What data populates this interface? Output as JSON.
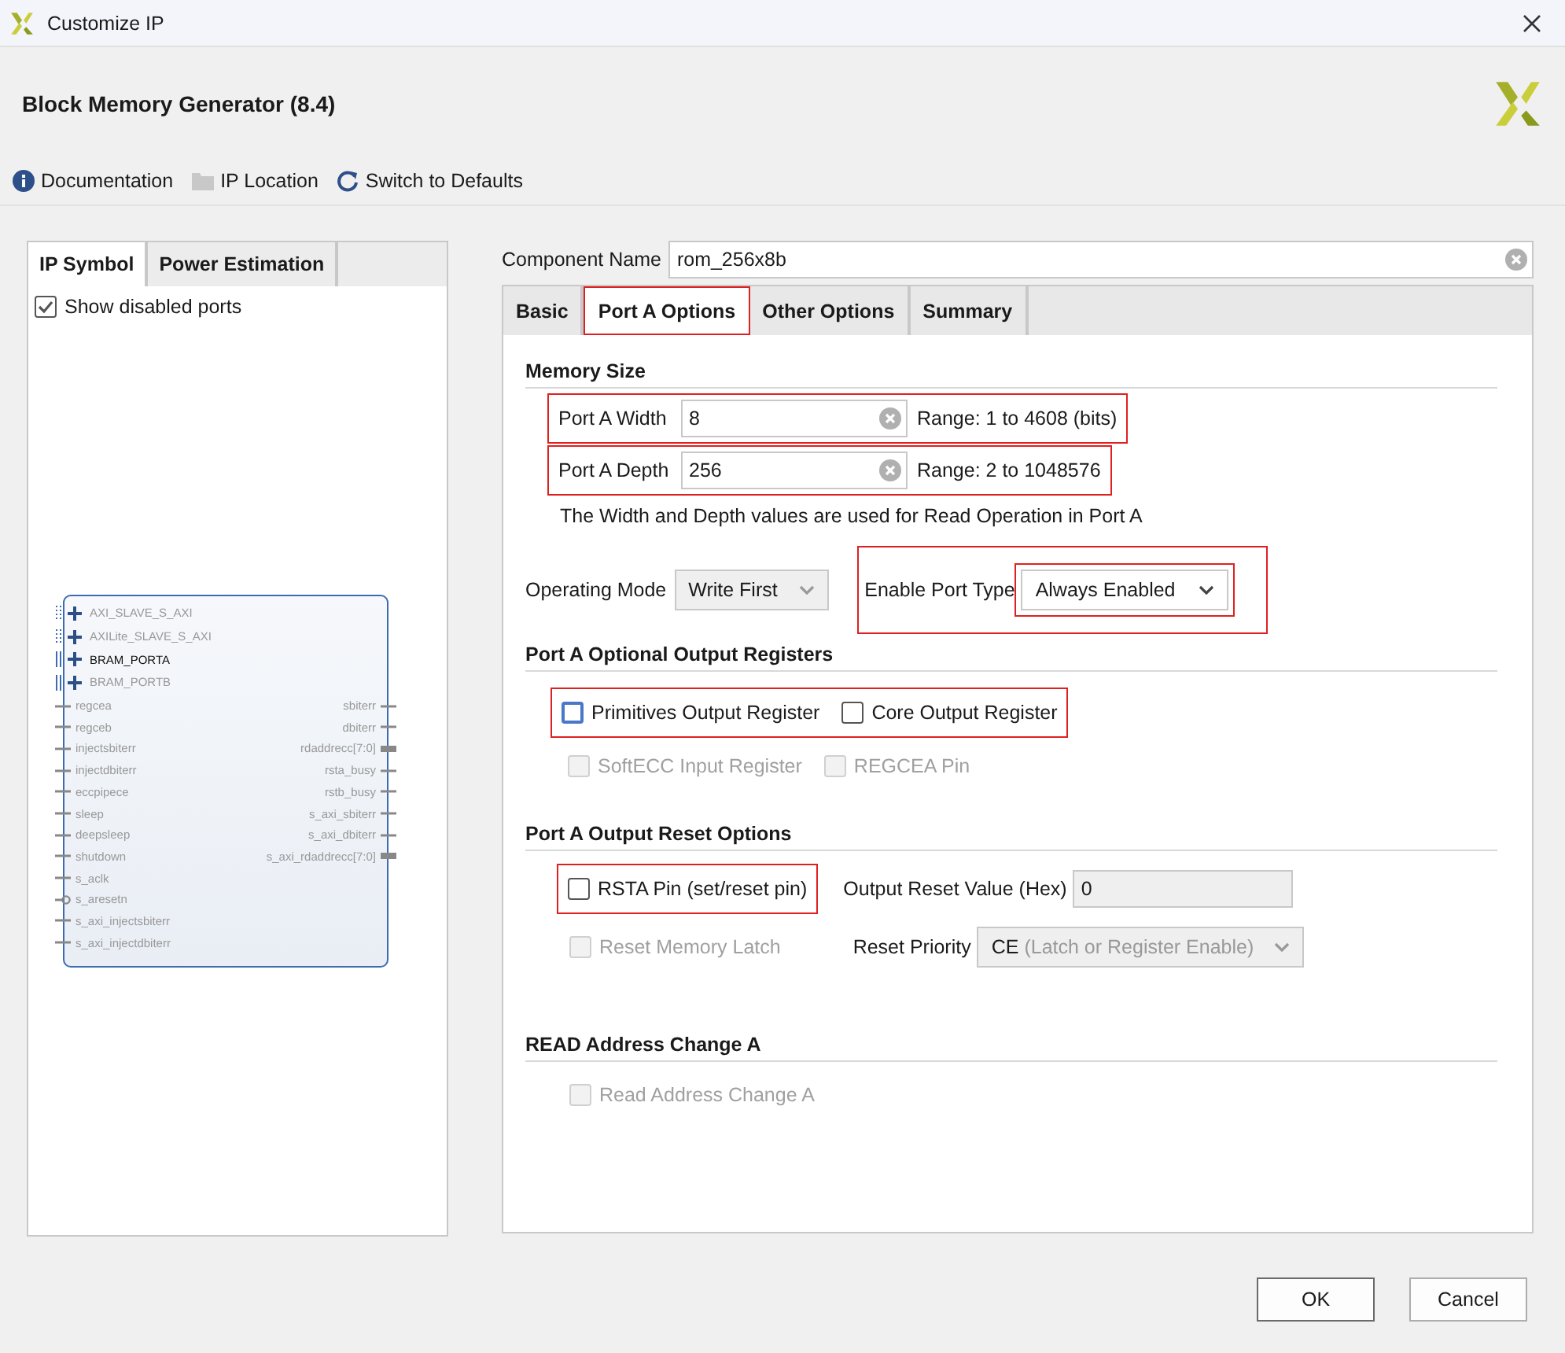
{
  "window": {
    "title": "Customize IP"
  },
  "header": {
    "title": "Block Memory Generator (8.4)"
  },
  "toolbar": [
    {
      "kind": "info",
      "label": "Documentation"
    },
    {
      "kind": "folder",
      "label": "IP Location"
    },
    {
      "kind": "refresh",
      "label": "Switch to Defaults"
    }
  ],
  "left_panel": {
    "tabs": [
      {
        "label": "IP Symbol",
        "selected": true
      },
      {
        "label": "Power Estimation",
        "selected": false
      }
    ],
    "show_disabled_ports": {
      "label": "Show disabled ports",
      "checked": true
    },
    "symbol": {
      "buses": [
        {
          "name": "AXI_SLAVE_S_AXI",
          "kind": "dotted",
          "enabled": false
        },
        {
          "name": "AXILite_SLAVE_S_AXI",
          "kind": "dotted",
          "enabled": false
        },
        {
          "name": "BRAM_PORTA",
          "kind": "solid",
          "enabled": true
        },
        {
          "name": "BRAM_PORTB",
          "kind": "solid",
          "enabled": false
        }
      ],
      "left_ports": [
        {
          "name": "regcea",
          "kind": "wire"
        },
        {
          "name": "regceb",
          "kind": "wire"
        },
        {
          "name": "injectsbiterr",
          "kind": "wire"
        },
        {
          "name": "injectdbiterr",
          "kind": "wire"
        },
        {
          "name": "eccpipece",
          "kind": "wire"
        },
        {
          "name": "sleep",
          "kind": "wire"
        },
        {
          "name": "deepsleep",
          "kind": "wire"
        },
        {
          "name": "shutdown",
          "kind": "wire"
        },
        {
          "name": "s_aclk",
          "kind": "wire"
        },
        {
          "name": "s_aresetn",
          "kind": "inverted"
        },
        {
          "name": "s_axi_injectsbiterr",
          "kind": "wire"
        },
        {
          "name": "s_axi_injectdbiterr",
          "kind": "wire"
        }
      ],
      "right_ports": [
        {
          "name": "sbiterr",
          "kind": "wire"
        },
        {
          "name": "dbiterr",
          "kind": "wire"
        },
        {
          "name": "rdaddrecc[7:0]",
          "kind": "bus"
        },
        {
          "name": "rsta_busy",
          "kind": "wire"
        },
        {
          "name": "rstb_busy",
          "kind": "wire"
        },
        {
          "name": "s_axi_sbiterr",
          "kind": "wire"
        },
        {
          "name": "s_axi_dbiterr",
          "kind": "wire"
        },
        {
          "name": "s_axi_rdaddrecc[7:0]",
          "kind": "bus"
        }
      ]
    }
  },
  "component_name": {
    "label": "Component Name",
    "value": "rom_256x8b"
  },
  "tabs": [
    {
      "label": "Basic",
      "selected": false,
      "highlighted": false
    },
    {
      "label": "Port A Options",
      "selected": true,
      "highlighted": true
    },
    {
      "label": "Other Options",
      "selected": false,
      "highlighted": false
    },
    {
      "label": "Summary",
      "selected": false,
      "highlighted": false
    }
  ],
  "memory_size": {
    "title": "Memory Size",
    "fields": [
      {
        "label": "Port A Width",
        "value": "8",
        "range": "Range: 1 to 4608 (bits)",
        "highlighted": true
      },
      {
        "label": "Port A Depth",
        "value": "256",
        "range": "Range: 2 to 1048576",
        "highlighted": true
      }
    ],
    "note": "The Width and Depth values are used for Read Operation in Port A"
  },
  "operating_mode": {
    "label": "Operating Mode",
    "value": "Write First",
    "disabled": true
  },
  "enable_port_type": {
    "label": "Enable Port Type",
    "value": "Always Enabled",
    "highlighted": true
  },
  "output_registers": {
    "title": "Port A Optional Output Registers",
    "rows": [
      {
        "highlighted": true,
        "items": [
          {
            "label": "Primitives Output Register",
            "checked": false,
            "disabled": false,
            "focused": true
          },
          {
            "label": "Core Output Register",
            "checked": false,
            "disabled": false,
            "focused": false
          }
        ]
      },
      {
        "highlighted": false,
        "items": [
          {
            "label": "SoftECC Input Register",
            "checked": false,
            "disabled": true,
            "focused": false
          },
          {
            "label": "REGCEA Pin",
            "checked": false,
            "disabled": true,
            "focused": false
          }
        ]
      }
    ]
  },
  "reset_options": {
    "title": "Port A Output Reset Options",
    "rsta_pin": {
      "label": "RSTA Pin (set/reset pin)",
      "checked": false,
      "disabled": false,
      "highlighted": true
    },
    "reset_value": {
      "label": "Output Reset Value (Hex)",
      "value": "0",
      "disabled": true
    },
    "memory_latch": {
      "label": "Reset Memory Latch",
      "checked": false,
      "disabled": true
    },
    "reset_priority": {
      "label": "Reset Priority",
      "value": "CE",
      "hint": "(Latch or Register Enable)",
      "disabled": true
    }
  },
  "read_address": {
    "title": "READ Address Change A",
    "checkbox": {
      "label": "Read Address Change A",
      "checked": false,
      "disabled": true
    }
  },
  "buttons": [
    {
      "label": "OK",
      "kind": "primary"
    },
    {
      "label": "Cancel",
      "kind": "secondary"
    }
  ]
}
